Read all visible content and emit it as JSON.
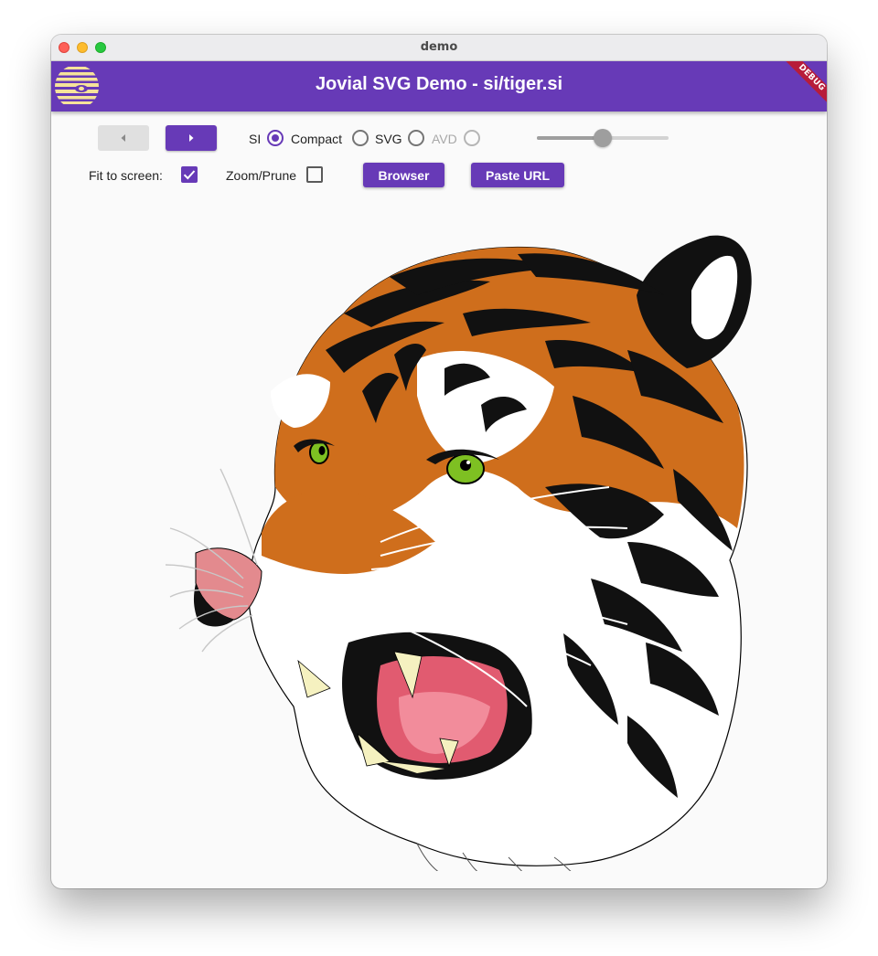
{
  "window": {
    "title": "demo"
  },
  "appbar": {
    "title": "Jovial SVG Demo - si/tiger.si",
    "debug_banner": "DEBUG",
    "logo_icon": "jovial-logo-icon"
  },
  "navigation": {
    "prev_icon": "arrow-left-icon",
    "next_icon": "arrow-right-icon"
  },
  "format": {
    "options": [
      {
        "label": "SI",
        "selected": true,
        "enabled": true
      },
      {
        "label": "Compact",
        "selected": false,
        "enabled": true
      },
      {
        "label": "SVG",
        "selected": false,
        "enabled": true
      },
      {
        "label": "AVD",
        "selected": false,
        "enabled": false
      }
    ]
  },
  "slider": {
    "value_fraction": 0.5
  },
  "options": {
    "fit_to_screen_label": "Fit to screen:",
    "fit_to_screen": true,
    "zoom_prune_label": "Zoom/Prune",
    "zoom_prune": false
  },
  "buttons": {
    "browser": "Browser",
    "paste_url": "Paste URL"
  },
  "colors": {
    "accent": "#673ab7",
    "debug": "#b71c3a",
    "tiger_orange": "#cf6e1c",
    "eye_green": "#7ec022"
  }
}
